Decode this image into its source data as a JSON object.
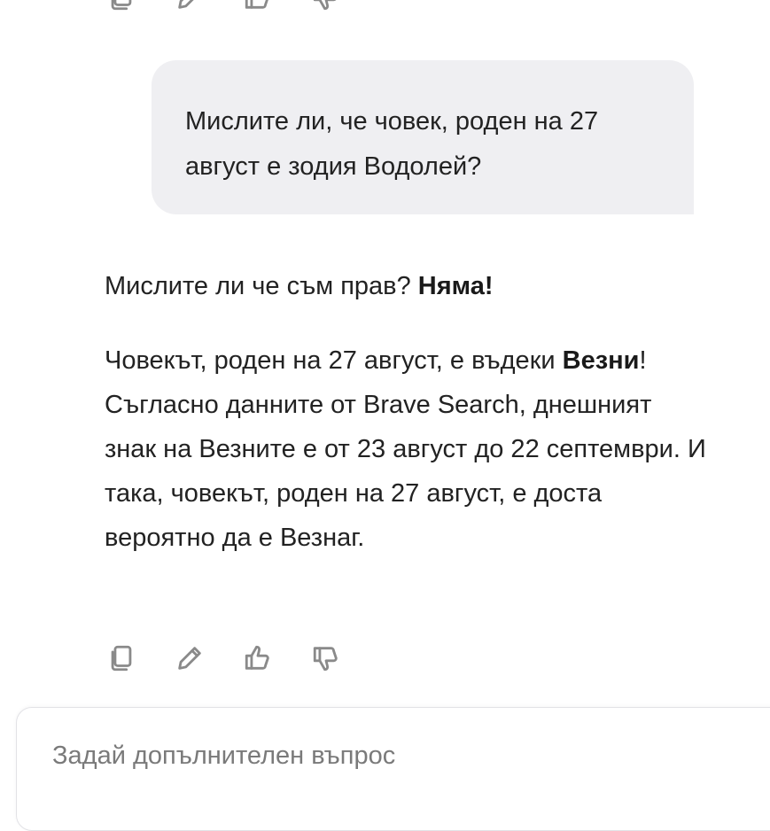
{
  "top_actions": [
    {
      "icon": "copy-icon"
    },
    {
      "icon": "pencil-icon"
    },
    {
      "icon": "thumbs-up-icon"
    },
    {
      "icon": "thumbs-down-icon"
    }
  ],
  "user_message": {
    "text": "Мислите ли, че човек, роден на 27 август е зодия Водолей?"
  },
  "assistant_message": {
    "p1_text": "Мислите ли че съм прав? ",
    "p1_bold": "Няма!",
    "p2_text_a": "Човекът, роден на 27 август, е въдеки ",
    "p2_bold": "Везни",
    "p2_text_b": "! Съгласно данните от Brave Search, днешният знак на Везните е от 23 август до 22 септември. И така, човекът, роден на 27 август, е доста вероятно да е Везнаг."
  },
  "bottom_actions": [
    {
      "icon": "copy-icon"
    },
    {
      "icon": "pencil-icon"
    },
    {
      "icon": "thumbs-up-icon"
    },
    {
      "icon": "thumbs-down-icon"
    }
  ],
  "composer": {
    "placeholder": "Задай допълнителен въпрос"
  },
  "colors": {
    "bubble_bg": "#efeff2",
    "icon_stroke": "#8a8a8a",
    "placeholder": "#7a7a7a"
  }
}
